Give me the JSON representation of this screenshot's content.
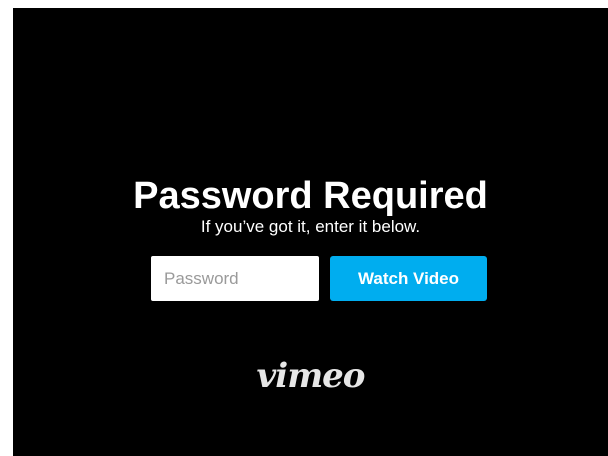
{
  "prompt": {
    "title": "Password Required",
    "subtitle": "If you’ve got it, enter it below."
  },
  "form": {
    "password_value": "",
    "password_placeholder": "Password",
    "submit_label": "Watch Video"
  },
  "brand": {
    "logo_text": "vimeo"
  },
  "colors": {
    "background": "#000000",
    "text": "#ffffff",
    "button": "#00adef",
    "logo": "#e6e6e6"
  }
}
